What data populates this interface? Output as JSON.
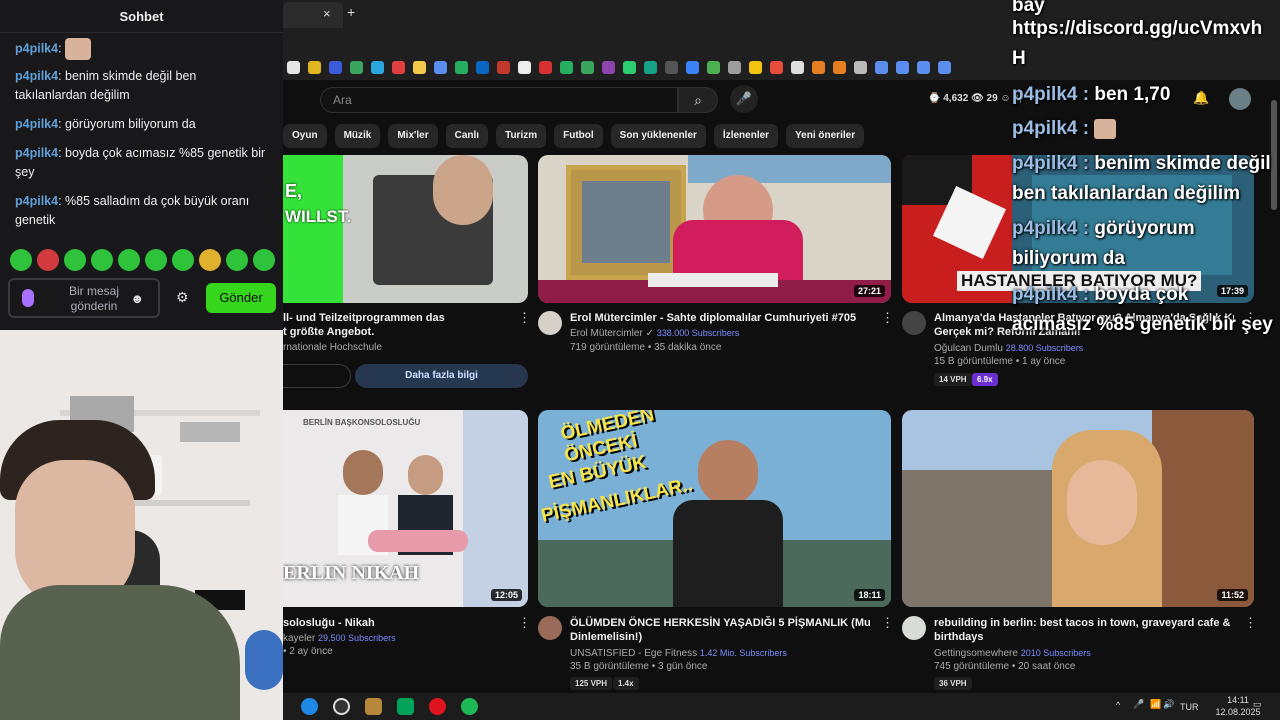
{
  "browser": {
    "tab_close": "×",
    "tab_new": "+"
  },
  "chat": {
    "title": "Sohbet",
    "messages": [
      {
        "user": "p4pilk4",
        "text": ""
      },
      {
        "user": "p4pilk4",
        "text": "benim skimde değil ben takılanlardan değilim"
      },
      {
        "user": "p4pilk4",
        "text": "görüyorum biliyorum da"
      },
      {
        "user": "p4pilk4",
        "text": "boyda çok acımasız %85 genetik bir şey"
      },
      {
        "user": "p4pilk4",
        "text": "%85 salladım da çok büyük oranı genetik"
      }
    ],
    "input_placeholder": "Bir mesaj gönderin",
    "send_label": "Gönder"
  },
  "youtube": {
    "search_placeholder": "Ara",
    "stats": "⌚ 4,632  👁 29  ☺ 4,",
    "chips": [
      "Oyun",
      "Müzik",
      "Mix'ler",
      "Canlı",
      "Turizm",
      "Futbol",
      "Son yüklenenler",
      "İzlenenler",
      "Yeni öneriler"
    ],
    "ad": {
      "title_line1": "ll- und Teilzeitprogrammen das",
      "title_line2": "t größte Angebot.",
      "channel": "rnationale Hochschule",
      "cta": "Daha fazla bilgi",
      "thumb_text1": "E,",
      "thumb_text2": "WILLST."
    },
    "videos": [
      {
        "title": "Erol Mütercimler - Sahte diplomalılar Cumhuriyeti #705",
        "channel": "Erol Mütercimler",
        "subs": "338.000 Subscribers",
        "meta": "719 görüntüleme • 35 dakika önce",
        "duration": "27:21"
      },
      {
        "title_line1": "Almanya'da Hastaneler Batıyor mu? Almanya'da Sağlık Krizi:",
        "title_line2": "Gerçek mi? Reform Zamanı!",
        "channel": "Oğulcan Dumlu",
        "subs": "28.800 Subscribers",
        "meta": "15 B görüntüleme • 1 ay önce",
        "vph": "14 VPH",
        "x": "6.9x",
        "duration": "17:39",
        "thumb_text": "HASTANELER BATIYOR MU?"
      },
      {
        "title": "solosluğu - Nikah",
        "channel": "kayeler",
        "subs": "29.500 Subscribers",
        "meta": "• 2 ay önce",
        "duration": "12:05",
        "thumb_text": "ERLIN NIKAH",
        "thumb_top": "BERLİN BAŞKONSOLOSLUĞU"
      },
      {
        "title_line1": "ÖLÜMDEN ÖNCE HERKESİN YAŞADIĞI 5 PİŞMANLIK (Mutlaka",
        "title_line2": "Dinlemelisin!)",
        "channel": "UNSATISFIED - Ege Fitness",
        "subs": "1.42 Mio. Subscribers",
        "meta": "35 B görüntüleme • 3 gün önce",
        "vph": "125 VPH",
        "x": "1.4x",
        "duration": "18:11",
        "thumb_lines": [
          "ÖLMEDEN",
          "ÖNCEKİ",
          "EN BÜYÜK",
          "PİŞMANLIKLAR.."
        ]
      },
      {
        "title_line1": "rebuilding in berlin: best tacos in town, graveyard cafe &",
        "title_line2": "birthdays",
        "channel": "Gettingsomewhere",
        "subs": "2010 Subscribers",
        "meta": "745 görüntüleme • 20 saat önce",
        "vph": "36 VPH",
        "duration": "11:52"
      }
    ]
  },
  "overlay": {
    "line1": "bay",
    "line2": "https://discord.gg/ucVmxvh",
    "line3": "H",
    "messages": [
      {
        "user": "p4pilk4 :",
        "text": " ben 1,70"
      },
      {
        "user": "p4pilk4 :",
        "text": ""
      },
      {
        "user": "p4pilk4 :",
        "text": " benim skimde değil"
      },
      {
        "user": "",
        "text": "ben takılanlardan değilim"
      },
      {
        "user": "p4pilk4 :",
        "text": " görüyorum"
      },
      {
        "user": "",
        "text": "biliyorum da"
      },
      {
        "user": "p4pilk4 :",
        "text": " boyda çok"
      },
      {
        "user": "",
        "text": "acımasız %85 genetik bir şey"
      }
    ]
  },
  "taskbar": {
    "lang": "TUR",
    "time": "14:11",
    "date": "12.08.2025"
  }
}
